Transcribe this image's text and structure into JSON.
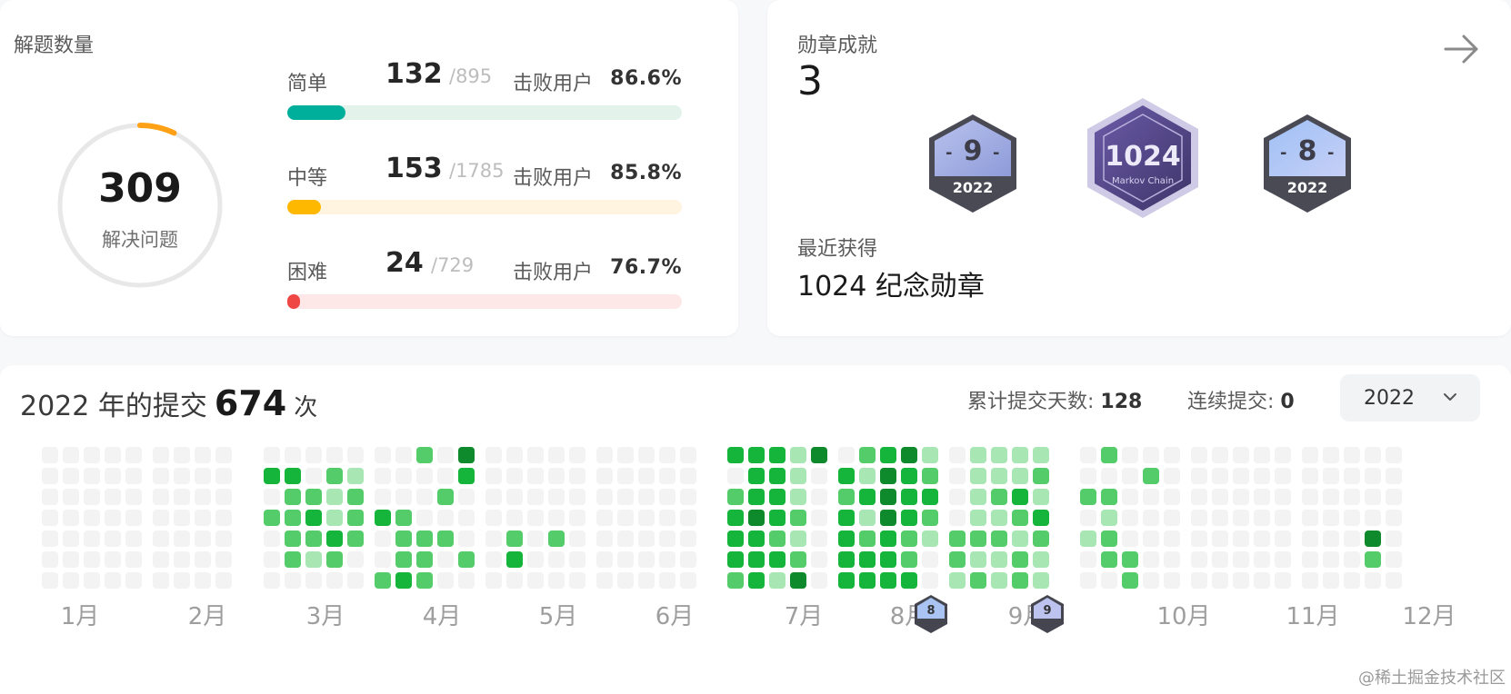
{
  "solved": {
    "title": "解题数量",
    "total": "309",
    "total_label": "解决问题",
    "ring_progress": 0.07,
    "beat_label": "击败用户",
    "rows": [
      {
        "name": "简单",
        "solved": "132",
        "total": "/895",
        "beat": "86.6%",
        "fraction": 0.147,
        "color": "#00af9b",
        "track": "#e3f3ec"
      },
      {
        "name": "中等",
        "solved": "153",
        "total": "/1785",
        "beat": "85.8%",
        "fraction": 0.086,
        "color": "#ffb800",
        "track": "#fff4e0"
      },
      {
        "name": "困难",
        "solved": "24",
        "total": "/729",
        "beat": "76.7%",
        "fraction": 0.033,
        "color": "#ef4743",
        "track": "#fde7e7"
      }
    ]
  },
  "badges": {
    "title": "勋章成就",
    "count": "3",
    "items": [
      {
        "name": "badge-september-2022",
        "big": "9",
        "year": "2022"
      },
      {
        "name": "badge-1024-markov-chain",
        "big": "1024",
        "sub": "Markov Chain"
      },
      {
        "name": "badge-august-2022",
        "big": "8",
        "year": "2022"
      }
    ],
    "recent_label": "最近获得",
    "recent_name": "1024 纪念勋章"
  },
  "submissions": {
    "year_prefix": "2022 年的提交",
    "count": "674",
    "unit": "次",
    "total_days_label": "累计提交天数: ",
    "total_days": "128",
    "streak_label": "连续提交: ",
    "streak": "0",
    "year_select": "2022",
    "months": [
      "1月",
      "2月",
      "3月",
      "4月",
      "5月",
      "6月",
      "7月",
      "8月",
      "9月",
      "10月",
      "11月",
      "12月"
    ],
    "mini_badges": [
      "8",
      "9"
    ],
    "colors": {
      "empty": "#f3f3f3",
      "l1": "#a8e6b4",
      "l2": "#55cc6a",
      "l3": "#14b53a",
      "l4": "#0e8a2c"
    }
  },
  "watermark": "@稀土掘金技术社区"
}
